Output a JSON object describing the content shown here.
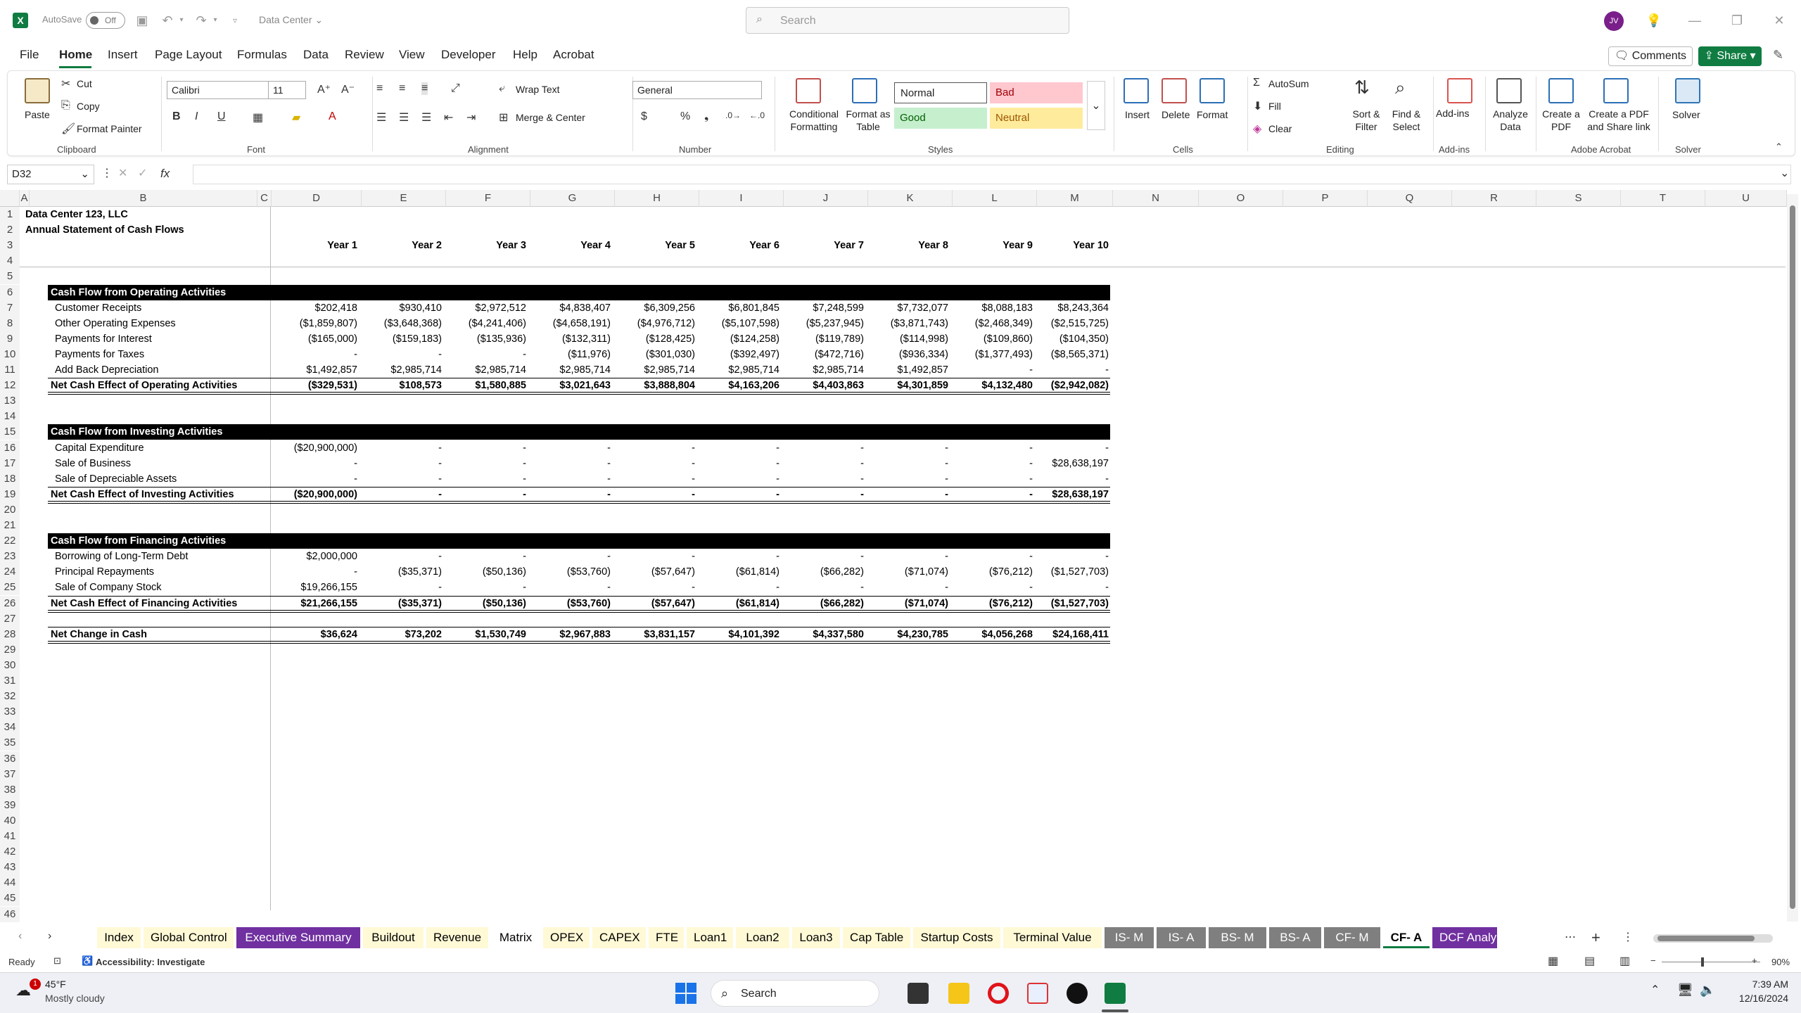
{
  "titlebar": {
    "app_icon": "excel-logo-icon",
    "app_letter": "X",
    "autosave_label": "AutoSave",
    "autosave_state": "Off",
    "doc_title": "Data Center",
    "search_placeholder": "Search",
    "avatar_initials": "JV"
  },
  "menu": {
    "items": [
      "File",
      "Home",
      "Insert",
      "Page Layout",
      "Formulas",
      "Data",
      "Review",
      "View",
      "Developer",
      "Help",
      "Acrobat"
    ],
    "active": "Home",
    "comments_label": "Comments",
    "share_label": "Share"
  },
  "ribbon": {
    "clipboard": {
      "paste": "Paste",
      "cut": "Cut",
      "copy": "Copy",
      "format_painter": "Format Painter",
      "label": "Clipboard"
    },
    "font": {
      "name": "Calibri",
      "size": "11",
      "label": "Font"
    },
    "alignment": {
      "wrap": "Wrap Text",
      "merge": "Merge & Center",
      "label": "Alignment"
    },
    "number": {
      "format": "General",
      "label": "Number"
    },
    "styles": {
      "conditional": "Conditional Formatting",
      "format_table": "Format as Table",
      "normal": "Normal",
      "bad": "Bad",
      "good": "Good",
      "neutral": "Neutral",
      "label": "Styles"
    },
    "cells": {
      "insert": "Insert",
      "delete": "Delete",
      "format": "Format",
      "label": "Cells"
    },
    "editing": {
      "autosum": "AutoSum",
      "fill": "Fill",
      "clear": "Clear",
      "sort": "Sort & Filter",
      "find": "Find & Select",
      "label": "Editing"
    },
    "addins": {
      "addins": "Add-ins",
      "label": "Add-ins"
    },
    "analyze": {
      "label": "Analyze Data"
    },
    "acrobat": {
      "create_pdf": "Create a PDF",
      "create_share": "Create a PDF and Share link",
      "label": "Adobe Acrobat"
    },
    "solver": {
      "solver": "Solver",
      "label": "Solver"
    },
    "colors": {
      "bad_bg": "#ffc7ce",
      "bad_fg": "#9c0006",
      "good_bg": "#c6efce",
      "good_fg": "#006100",
      "neutral_bg": "#ffeb9c",
      "neutral_fg": "#9c5700"
    }
  },
  "formula_bar": {
    "name_box": "D32",
    "fx": "fx",
    "value": ""
  },
  "columns": [
    "A",
    "B",
    "C",
    "D",
    "E",
    "F",
    "G",
    "H",
    "I",
    "J",
    "K",
    "L",
    "M",
    "N",
    "O",
    "P",
    "Q",
    "R",
    "S",
    "T",
    "U"
  ],
  "sheet": {
    "company": "Data Center 123, LLC",
    "report": "Annual Statement of Cash Flows",
    "years": [
      "Year 1",
      "Year 2",
      "Year 3",
      "Year 4",
      "Year 5",
      "Year 6",
      "Year 7",
      "Year 8",
      "Year 9",
      "Year 10"
    ],
    "operating": {
      "header": "Cash Flow from Operating Activities",
      "rows": [
        {
          "label": "Customer Receipts",
          "values": [
            "$202,418",
            "$930,410",
            "$2,972,512",
            "$4,838,407",
            "$6,309,256",
            "$6,801,845",
            "$7,248,599",
            "$7,732,077",
            "$8,088,183",
            "$8,243,364"
          ]
        },
        {
          "label": "Other Operating Expenses",
          "values": [
            "($1,859,807)",
            "($3,648,368)",
            "($4,241,406)",
            "($4,658,191)",
            "($4,976,712)",
            "($5,107,598)",
            "($5,237,945)",
            "($3,871,743)",
            "($2,468,349)",
            "($2,515,725)"
          ]
        },
        {
          "label": "Payments for Interest",
          "values": [
            "($165,000)",
            "($159,183)",
            "($135,936)",
            "($132,311)",
            "($128,425)",
            "($124,258)",
            "($119,789)",
            "($114,998)",
            "($109,860)",
            "($104,350)"
          ]
        },
        {
          "label": "Payments for Taxes",
          "values": [
            "-",
            "-",
            "-",
            "($11,976)",
            "($301,030)",
            "($392,497)",
            "($472,716)",
            "($936,334)",
            "($1,377,493)",
            "($8,565,371)"
          ]
        },
        {
          "label": "Add Back Depreciation",
          "values": [
            "$1,492,857",
            "$2,985,714",
            "$2,985,714",
            "$2,985,714",
            "$2,985,714",
            "$2,985,714",
            "$2,985,714",
            "$1,492,857",
            "-",
            "-"
          ]
        }
      ],
      "total_label": "Net Cash Effect of Operating Activities",
      "total": [
        "($329,531)",
        "$108,573",
        "$1,580,885",
        "$3,021,643",
        "$3,888,804",
        "$4,163,206",
        "$4,403,863",
        "$4,301,859",
        "$4,132,480",
        "($2,942,082)"
      ]
    },
    "investing": {
      "header": "Cash Flow from Investing Activities",
      "rows": [
        {
          "label": "Capital Expenditure",
          "values": [
            "($20,900,000)",
            "-",
            "-",
            "-",
            "-",
            "-",
            "-",
            "-",
            "-",
            "-"
          ]
        },
        {
          "label": "Sale of Business",
          "values": [
            "-",
            "-",
            "-",
            "-",
            "-",
            "-",
            "-",
            "-",
            "-",
            "$28,638,197"
          ]
        },
        {
          "label": "Sale of Depreciable Assets",
          "values": [
            "-",
            "-",
            "-",
            "-",
            "-",
            "-",
            "-",
            "-",
            "-",
            "-"
          ]
        }
      ],
      "total_label": "Net Cash Effect of Investing Activities",
      "total": [
        "($20,900,000)",
        "-",
        "-",
        "-",
        "-",
        "-",
        "-",
        "-",
        "-",
        "$28,638,197"
      ]
    },
    "financing": {
      "header": "Cash Flow from Financing Activities",
      "rows": [
        {
          "label": "Borrowing of Long-Term Debt",
          "values": [
            "$2,000,000",
            "-",
            "-",
            "-",
            "-",
            "-",
            "-",
            "-",
            "-",
            "-"
          ]
        },
        {
          "label": "Principal Repayments",
          "values": [
            "-",
            "($35,371)",
            "($50,136)",
            "($53,760)",
            "($57,647)",
            "($61,814)",
            "($66,282)",
            "($71,074)",
            "($76,212)",
            "($1,527,703)"
          ]
        },
        {
          "label": "Sale of Company Stock",
          "values": [
            "$19,266,155",
            "-",
            "-",
            "-",
            "-",
            "-",
            "-",
            "-",
            "-",
            "-"
          ]
        }
      ],
      "total_label": "Net Cash Effect of Financing Activities",
      "total": [
        "$21,266,155",
        "($35,371)",
        "($50,136)",
        "($53,760)",
        "($57,647)",
        "($61,814)",
        "($66,282)",
        "($71,074)",
        "($76,212)",
        "($1,527,703)"
      ]
    },
    "net_change_label": "Net Change in Cash",
    "net_change": [
      "$36,624",
      "$73,202",
      "$1,530,749",
      "$2,967,883",
      "$3,831,157",
      "$4,101,392",
      "$4,337,580",
      "$4,230,785",
      "$4,056,268",
      "$24,168,411"
    ]
  },
  "tabs": [
    {
      "name": "Index",
      "bg": "#fff9d6",
      "fg": "#000"
    },
    {
      "name": "Global Control",
      "bg": "#fff9d6",
      "fg": "#000"
    },
    {
      "name": "Executive Summary",
      "bg": "#7030a0",
      "fg": "#fff"
    },
    {
      "name": "Buildout",
      "bg": "#fff9d6",
      "fg": "#000"
    },
    {
      "name": "Revenue",
      "bg": "#fff9d6",
      "fg": "#000"
    },
    {
      "name": "Matrix",
      "bg": "#ffffff",
      "fg": "#000"
    },
    {
      "name": "OPEX",
      "bg": "#fff9d6",
      "fg": "#000"
    },
    {
      "name": "CAPEX",
      "bg": "#fff9d6",
      "fg": "#000"
    },
    {
      "name": "FTE",
      "bg": "#fff9d6",
      "fg": "#000"
    },
    {
      "name": "Loan1",
      "bg": "#fff9d6",
      "fg": "#000"
    },
    {
      "name": "Loan2",
      "bg": "#fff9d6",
      "fg": "#000"
    },
    {
      "name": "Loan3",
      "bg": "#fff9d6",
      "fg": "#000"
    },
    {
      "name": "Cap Table",
      "bg": "#fff9d6",
      "fg": "#000"
    },
    {
      "name": "Startup Costs",
      "bg": "#fff9d6",
      "fg": "#000"
    },
    {
      "name": "Terminal Value",
      "bg": "#fff9d6",
      "fg": "#000"
    },
    {
      "name": "IS- M",
      "bg": "#7f7f7f",
      "fg": "#fff"
    },
    {
      "name": "IS- A",
      "bg": "#7f7f7f",
      "fg": "#fff"
    },
    {
      "name": "BS- M",
      "bg": "#7f7f7f",
      "fg": "#fff"
    },
    {
      "name": "BS- A",
      "bg": "#7f7f7f",
      "fg": "#fff"
    },
    {
      "name": "CF- M",
      "bg": "#7f7f7f",
      "fg": "#fff"
    },
    {
      "name": "CF- A",
      "bg": "#ffffff",
      "fg": "#000"
    },
    {
      "name": "DCF Analy",
      "bg": "#7030a0",
      "fg": "#fff"
    }
  ],
  "active_tab": "CF- A",
  "status": {
    "ready": "Ready",
    "accessibility": "Accessibility: Investigate",
    "zoom": "90%"
  },
  "taskbar": {
    "temp": "45°F",
    "weather": "Mostly cloudy",
    "weather_badge": "1",
    "search": "Search",
    "time": "7:39 AM",
    "date": "12/16/2024"
  }
}
